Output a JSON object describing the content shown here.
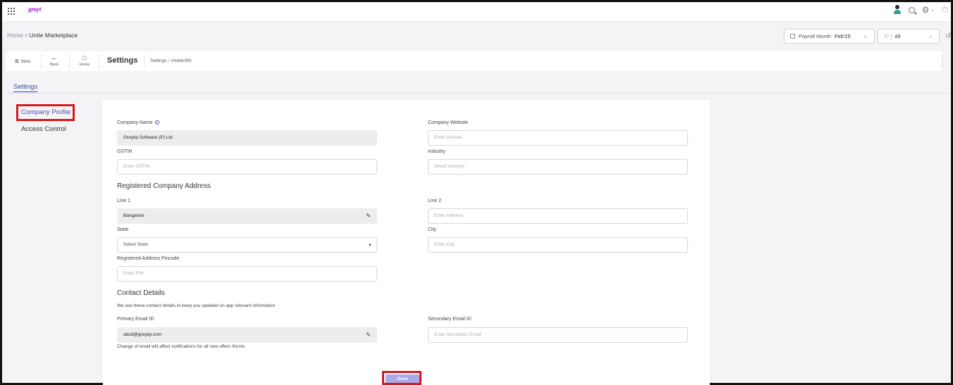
{
  "app": {
    "logo_text": "greyt"
  },
  "breadcrumb": {
    "home": "Home",
    "separator": ">",
    "current": "Unite Marketplace"
  },
  "filters": {
    "payroll_label": "Payroll Month:",
    "payroll_value": "Feb'25",
    "group_value": "All"
  },
  "toolbar": {
    "more": "More",
    "back": "Back",
    "home": "Home",
    "title": "Settings",
    "path": "Settings  ›  VioletLMS"
  },
  "tabs": {
    "settings": "Settings"
  },
  "sidebar": {
    "items": [
      {
        "label": "Company Profile"
      },
      {
        "label": "Access Control"
      }
    ]
  },
  "form": {
    "company_name": {
      "label": "Company Name",
      "value": "Greytip Software (P) Ltd"
    },
    "company_website": {
      "label": "Company Website",
      "placeholder": "Enter Domain"
    },
    "gstin": {
      "label": "GSTIN",
      "placeholder": "Enter GSTIN"
    },
    "industry": {
      "label": "Industry",
      "placeholder": "Select Industry"
    },
    "address_heading": "Registered Company Address",
    "line1": {
      "label": "Line 1",
      "value": "Bangalore"
    },
    "line2": {
      "label": "Line 2",
      "placeholder": "Enter Address"
    },
    "state": {
      "label": "State",
      "value": "Select State"
    },
    "city": {
      "label": "City",
      "placeholder": "Enter City"
    },
    "pincode": {
      "label": "Registered Address Pincode",
      "placeholder": "Enter PIN"
    },
    "contact_heading": "Contact Details",
    "contact_note": "We use these contact details to keep you updated on app relevant information",
    "primary_email": {
      "label": "Primary Email ID",
      "value": "abcd@greytip.com"
    },
    "secondary_email": {
      "label": "Secondary Email ID",
      "placeholder": "Enter Secondary Email"
    },
    "email_note": "Change of email will affect notifications for all new offers /forms",
    "save": "Save"
  },
  "colors": {
    "accent": "#4a52a8",
    "highlight": "#d4191d",
    "save_bg": "#a7a9e8"
  }
}
